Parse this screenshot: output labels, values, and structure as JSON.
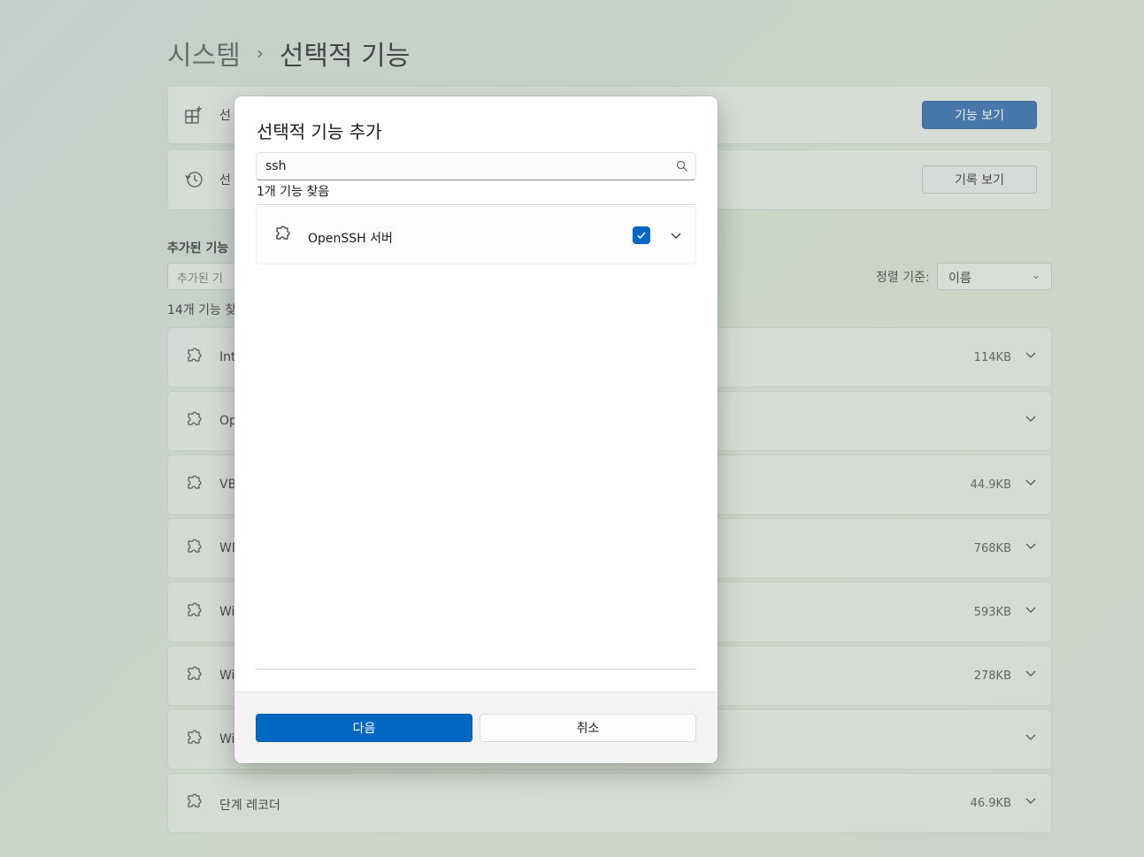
{
  "breadcrumb": {
    "parent": "시스템",
    "separator": "›",
    "current": "선택적 기능"
  },
  "cards": [
    {
      "icon": "add-feature-icon",
      "label": "선",
      "button": "기능 보기"
    },
    {
      "icon": "history-icon",
      "label": "선",
      "button": "기록 보기"
    }
  ],
  "installed": {
    "section_title": "추가된 기능",
    "search_placeholder": "추가된 기",
    "sort_label": "정렬 기준:",
    "sort_value": "이름",
    "count": "14개 기능 찾",
    "items": [
      {
        "name": "Int",
        "size": "114KB"
      },
      {
        "name": "Op",
        "size": ""
      },
      {
        "name": "VB",
        "size": "44.9KB"
      },
      {
        "name": "WM",
        "size": "768KB"
      },
      {
        "name": "Wi",
        "size": "593KB"
      },
      {
        "name": "Wi",
        "size": "278KB"
      },
      {
        "name": "Wi",
        "size": ""
      },
      {
        "name": "단계 레코더",
        "size": "46.9KB"
      }
    ]
  },
  "dialog": {
    "title": "선택적 기능 추가",
    "search_value": "ssh",
    "found": "1개 기능 찾음",
    "results": [
      {
        "name": "OpenSSH 서버",
        "checked": true
      }
    ],
    "next_button": "다음",
    "cancel_button": "취소"
  },
  "colors": {
    "accent": "#0067c0"
  }
}
